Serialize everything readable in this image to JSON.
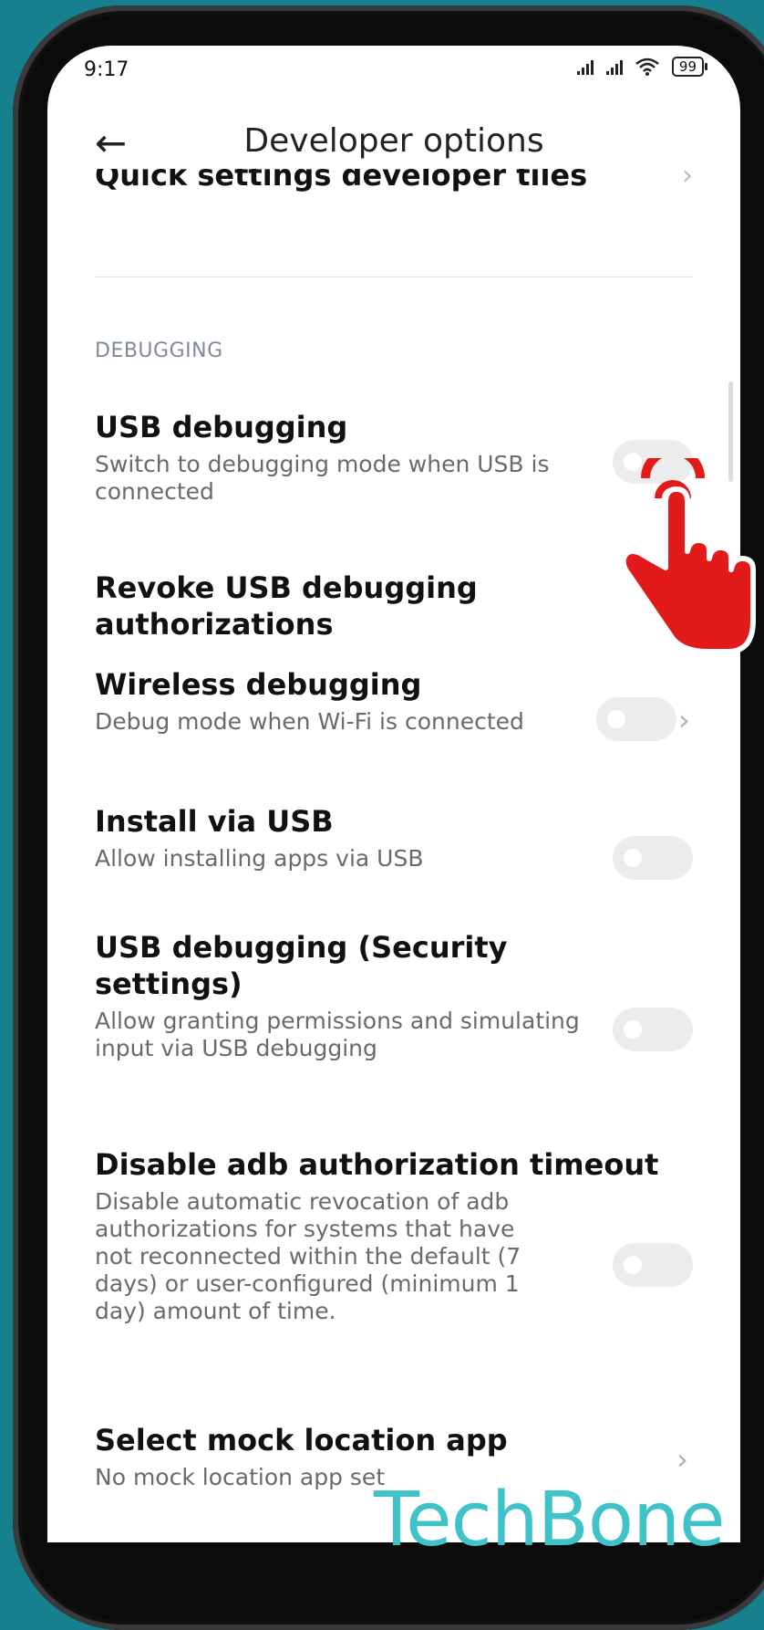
{
  "status_bar": {
    "time": "9:17",
    "battery": "99"
  },
  "header": {
    "title": "Developer options"
  },
  "partial_item": {
    "title": "Quick settings developer tiles"
  },
  "section": {
    "label": "DEBUGGING"
  },
  "items": [
    {
      "title": "USB debugging",
      "subtitle": "Switch to debugging mode when USB is connected",
      "control": "toggle",
      "state": "off"
    },
    {
      "title": "Revoke USB debugging authorizations",
      "control": "none"
    },
    {
      "title": "Wireless debugging",
      "subtitle": "Debug mode when Wi-Fi is connected",
      "control": "toggle+chevron",
      "state": "off"
    },
    {
      "title": "Install via USB",
      "subtitle": "Allow installing apps via USB",
      "control": "toggle",
      "state": "off"
    },
    {
      "title": "USB debugging (Security settings)",
      "subtitle": "Allow granting permissions and simulating input via USB debugging",
      "control": "toggle",
      "state": "off"
    },
    {
      "title": "Disable adb authorization timeout",
      "subtitle": "Disable automatic revocation of adb authorizations for systems that have not reconnected within the default (7 days) or user-configured (minimum 1 day) amount of time.",
      "control": "toggle",
      "state": "off"
    },
    {
      "title": "Select mock location app",
      "subtitle": "No mock location app set",
      "control": "chevron"
    }
  ],
  "watermark": {
    "text": "TechBone"
  },
  "colors": {
    "background": "#17808f",
    "hand_icon": "#e21a1a",
    "watermark": "#3fc3c8"
  }
}
